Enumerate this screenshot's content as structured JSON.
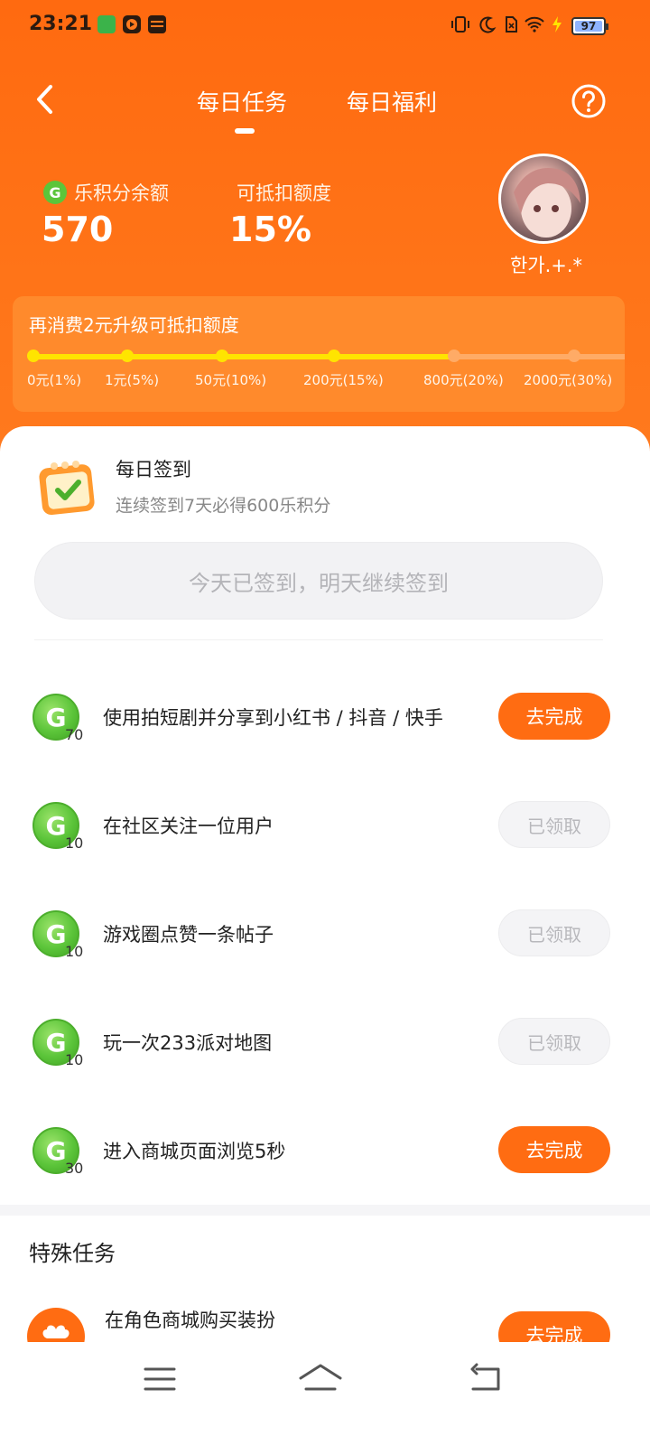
{
  "status_bar": {
    "time": "23:21",
    "battery": "97"
  },
  "nav": {
    "tab_tasks": "每日任务",
    "tab_welfare": "每日福利"
  },
  "points": {
    "balance_label": "乐积分余额",
    "balance_value": "570",
    "deduct_label": "可抵扣额度",
    "deduct_value": "15%"
  },
  "user": {
    "name": "한가.+.*"
  },
  "level": {
    "title": "再消费2元升级可抵扣额度",
    "steps": [
      "0元(1%)",
      "1元(5%)",
      "50元(10%)",
      "200元(15%)",
      "800元(20%)",
      "2000元(30%)"
    ]
  },
  "checkin": {
    "title": "每日签到",
    "subtitle": "连续签到7天必得600乐积分",
    "button": "今天已签到，明天继续签到"
  },
  "tasks": [
    {
      "points": "70",
      "text": "使用拍短剧并分享到小红书 / 抖音 / 快手",
      "action": "去完成",
      "done": false
    },
    {
      "points": "10",
      "text": "在社区关注一位用户",
      "action": "已领取",
      "done": true
    },
    {
      "points": "10",
      "text": "游戏圈点赞一条帖子",
      "action": "已领取",
      "done": true
    },
    {
      "points": "10",
      "text": "玩一次233派对地图",
      "action": "已领取",
      "done": true
    },
    {
      "points": "30",
      "text": "进入商城页面浏览5秒",
      "action": "去完成",
      "done": false
    }
  ],
  "special": {
    "title": "特殊任务",
    "item_text": "在角色商城购买装扮",
    "item_action": "去完成"
  },
  "coin_letter": "G",
  "colors": {
    "brand": "#FF6A10",
    "coin": "#5CC53A",
    "progress": "#FFE400"
  }
}
